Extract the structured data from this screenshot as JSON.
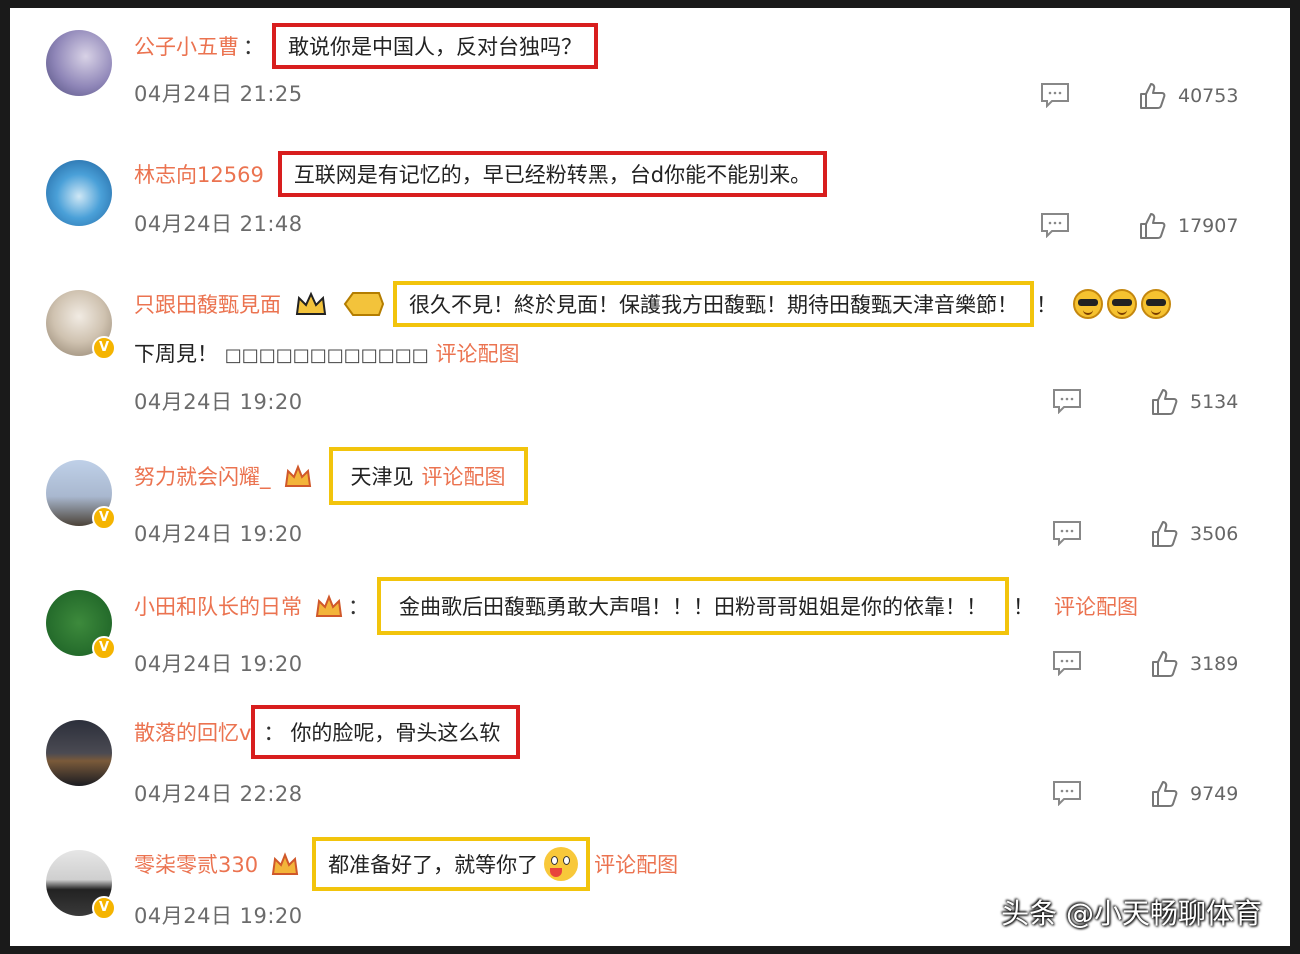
{
  "comments": [
    {
      "username": "公子小五曹",
      "colon": "：",
      "text": "敢说你是中国人，反对台独吗？",
      "time": "04月24日 21:25",
      "likes": "40753",
      "verified": false,
      "highlight": "red"
    },
    {
      "username": "林志向12569",
      "text": "互联网是有记忆的，早已经粉转黑，台d你能不能别来。",
      "time": "04月24日 21:48",
      "likes": "17907",
      "verified": false,
      "highlight": "red"
    },
    {
      "username": "只跟田馥甄見面",
      "level_badge": "1",
      "text": "很久不見！終於見面！保護我方田馥甄！期待田馥甄天津音樂節！",
      "trailing": "！",
      "line2_text": "下周見！",
      "line2_squares": "□□□□□□□□□□□□",
      "line2_link": "评论配图",
      "time": "04月24日 19:20",
      "likes": "5134",
      "verified": true,
      "highlight": "yellow"
    },
    {
      "username": "努力就会闪耀_",
      "text": "天津见",
      "link": "评论配图",
      "time": "04月24日 19:20",
      "likes": "3506",
      "verified": true,
      "highlight": "yellow"
    },
    {
      "username": "小田和队长的日常",
      "colon": "：",
      "text": "金曲歌后田馥甄勇敢大声唱！！！田粉哥哥姐姐是你的依靠！！",
      "trailing": "！",
      "link": "评论配图",
      "time": "04月24日 19:20",
      "likes": "3189",
      "verified": true,
      "highlight": "yellow"
    },
    {
      "username": "散落的回忆v",
      "colon": "：",
      "text": "你的脸呢，骨头这么软",
      "time": "04月24日 22:28",
      "likes": "9749",
      "verified": false,
      "highlight": "red"
    },
    {
      "username": "零柒零贰330",
      "text": "都准备好了，就等你了",
      "link": "评论配图",
      "time": "04月24日 19:20",
      "likes": "",
      "verified": true,
      "highlight": "yellow"
    }
  ],
  "watermark": "头条 @小天畅聊体育",
  "colors": {
    "username": "#eb7350",
    "red_box": "#d81e1e",
    "yellow_box": "#f2c40c",
    "verified": "#f5b400"
  },
  "icons": [
    "comment-icon",
    "thumb-up-icon",
    "crown-icon",
    "verified-icon"
  ]
}
